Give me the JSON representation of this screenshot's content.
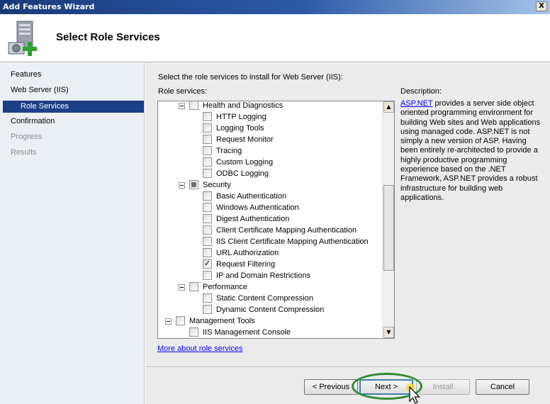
{
  "window": {
    "title": "Add Features Wizard",
    "close_glyph": "X"
  },
  "header": {
    "title": "Select Role Services"
  },
  "nav": {
    "items": [
      {
        "label": "Features",
        "state": "normal"
      },
      {
        "label": "Web Server (IIS)",
        "state": "normal"
      },
      {
        "label": "Role Services",
        "state": "selected"
      },
      {
        "label": "Confirmation",
        "state": "normal"
      },
      {
        "label": "Progress",
        "state": "disabled"
      },
      {
        "label": "Results",
        "state": "disabled"
      }
    ]
  },
  "main": {
    "instruction": "Select the role services to install for Web Server (IIS):",
    "role_services_label": "Role services:",
    "description_label": "Description:",
    "description_link": "ASP.NET",
    "description_body": " provides a server side object oriented programming environment for building Web sites and Web applications using managed code. ASP.NET is not simply a new version of ASP. Having been entirely re-architected to provide a highly productive programming experience based on the .NET Framework, ASP.NET provides a robust infrastructure for building web applications.",
    "more_link": "More about role services"
  },
  "tree": [
    {
      "label": "Health and Diagnostics",
      "level": 1,
      "expander": true,
      "state": "unchecked"
    },
    {
      "label": "HTTP Logging",
      "level": 2,
      "state": "unchecked"
    },
    {
      "label": "Logging Tools",
      "level": 2,
      "state": "unchecked"
    },
    {
      "label": "Request Monitor",
      "level": 2,
      "state": "unchecked"
    },
    {
      "label": "Tracing",
      "level": 2,
      "state": "unchecked"
    },
    {
      "label": "Custom Logging",
      "level": 2,
      "state": "unchecked"
    },
    {
      "label": "ODBC Logging",
      "level": 2,
      "state": "unchecked"
    },
    {
      "label": "Security",
      "level": 1,
      "expander": true,
      "state": "partial"
    },
    {
      "label": "Basic Authentication",
      "level": 2,
      "state": "unchecked"
    },
    {
      "label": "Windows Authentication",
      "level": 2,
      "state": "unchecked"
    },
    {
      "label": "Digest Authentication",
      "level": 2,
      "state": "unchecked"
    },
    {
      "label": "Client Certificate Mapping Authentication",
      "level": 2,
      "state": "unchecked"
    },
    {
      "label": "IIS Client Certificate Mapping Authentication",
      "level": 2,
      "state": "unchecked"
    },
    {
      "label": "URL Authorization",
      "level": 2,
      "state": "unchecked"
    },
    {
      "label": "Request Filtering",
      "level": 2,
      "state": "checked"
    },
    {
      "label": "IP and Domain Restrictions",
      "level": 2,
      "state": "unchecked"
    },
    {
      "label": "Performance",
      "level": 1,
      "expander": true,
      "state": "unchecked"
    },
    {
      "label": "Static Content Compression",
      "level": 2,
      "state": "unchecked"
    },
    {
      "label": "Dynamic Content Compression",
      "level": 2,
      "state": "unchecked"
    },
    {
      "label": "Management Tools",
      "level": 0,
      "expander": true,
      "state": "unchecked"
    },
    {
      "label": "IIS Management Console",
      "level": 1,
      "state": "unchecked"
    }
  ],
  "buttons": {
    "previous": "< Previous",
    "next": "Next >",
    "install": "Install",
    "cancel": "Cancel"
  }
}
